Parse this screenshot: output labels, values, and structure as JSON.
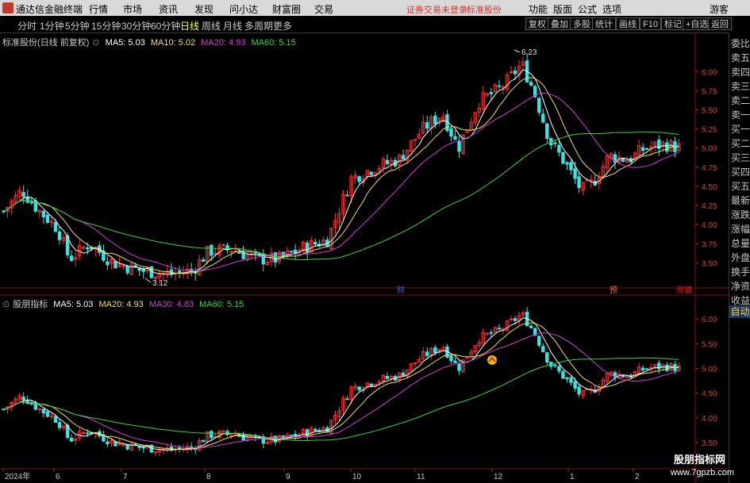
{
  "app": {
    "title": "通达信金融终端"
  },
  "menu": {
    "items": [
      "行情",
      "市场",
      "资讯",
      "发现",
      "问小达",
      "财富圈",
      "交易"
    ],
    "notice": "证券交易未登录",
    "stock_label": "标准股份",
    "right_items": [
      "功能",
      "版面",
      "公式",
      "选项"
    ],
    "guest": "游客"
  },
  "toolbar": {
    "periods": [
      "分时",
      "1分钟",
      "5分钟",
      "15分钟",
      "30分钟",
      "60分钟",
      "日线",
      "周线",
      "月线",
      "多周期",
      "更多"
    ],
    "active_period": "日线",
    "buttons": [
      "复权",
      "叠加",
      "多股",
      "统计",
      "画线",
      "F10",
      "标记",
      "+自选",
      "返回"
    ]
  },
  "price_panel": {
    "legend_title": "标准股份(日线 前复权)",
    "ma": [
      {
        "label": "MA5: 5.03",
        "color": "#ffffff"
      },
      {
        "label": "MA10: 5.02",
        "color": "#f0e060"
      },
      {
        "label": "MA20: 4.93",
        "color": "#d040d0"
      },
      {
        "label": "MA60: 5.15",
        "color": "#40d040"
      }
    ],
    "high_label": "6.23",
    "low_label": "3.12",
    "axis_labels": [
      "6.00",
      "5.75",
      "5.50",
      "5.25",
      "5.00",
      "4.75",
      "4.50",
      "4.25",
      "4.00",
      "3.75",
      "3.50"
    ],
    "event_markers": [
      "财",
      "预",
      "涨幅"
    ]
  },
  "indicator_panel": {
    "legend_title": "股朋指标",
    "ma": [
      {
        "label": "MA5: 5.03",
        "color": "#ffffff"
      },
      {
        "label": "MA20: 4.93",
        "color": "#f0e060"
      },
      {
        "label": "MA30: 4.83",
        "color": "#d040d0"
      },
      {
        "label": "MA60: 5.15",
        "color": "#40d040"
      }
    ],
    "axis_labels": [
      "6.00",
      "5.50",
      "5.00",
      "4.50",
      "4.00",
      "3.50"
    ]
  },
  "time_axis": [
    "2024年",
    "6",
    "7",
    "8",
    "9",
    "10",
    "11",
    "12",
    "1",
    "2"
  ],
  "right_panel": {
    "items": [
      "委比",
      "卖五",
      "卖四",
      "卖三",
      "卖二",
      "卖一",
      "买一",
      "买二",
      "买三",
      "买四",
      "买五",
      "最新",
      "涨跌",
      "涨幅",
      "总量",
      "外盘",
      "换手",
      "净资",
      "收益"
    ],
    "auto_button": "自动"
  },
  "watermark": {
    "line1": "股朋指标网",
    "line2": "www.7gpzb.com"
  },
  "colors": {
    "up": "#ff3030",
    "down": "#40e0e0",
    "ma5": "#ffffff",
    "ma10": "#f0e060",
    "ma20": "#d040d0",
    "ma60": "#40d040"
  }
}
